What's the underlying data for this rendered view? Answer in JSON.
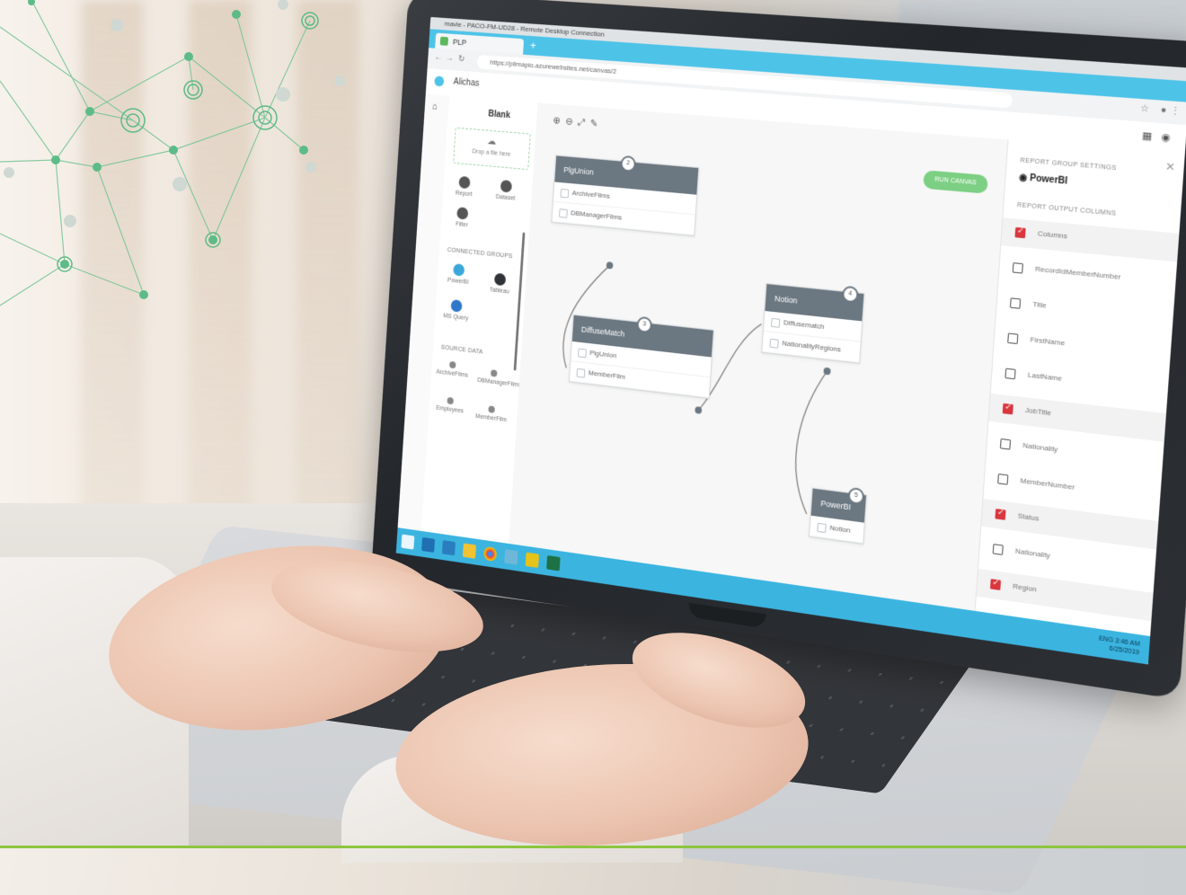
{
  "window_title": "mavle - PACO-FM-UD28 - Remote Desktop Connection",
  "browser": {
    "tab_label": "PLP",
    "url": "https://plimapio.azurewebsites.net/canvas/2"
  },
  "app": {
    "name": "Alichas"
  },
  "palette": {
    "title": "Blank",
    "dropzone": "Drop a file here",
    "items": [
      "Report",
      "Dataset",
      "Filter"
    ],
    "connected_section": "CONNECTED GROUPS",
    "connected_items": [
      "PowerBI",
      "Tableau",
      "MS Query"
    ],
    "sources_section": "SOURCE DATA",
    "source_items": [
      "ArchiveFilms",
      "DBManagerFilms",
      "Employees",
      "MemberFilm"
    ]
  },
  "canvas": {
    "run_button": "RUN CANVAS",
    "nodes": [
      {
        "title": "PlgUnion",
        "badge": "2",
        "rows": [
          "ArchiveFilms",
          "DBManagerFilms"
        ]
      },
      {
        "title": "DiffuseMatch",
        "badge": "3",
        "rows": [
          "PlgUnion",
          "MemberFilm"
        ]
      },
      {
        "title": "Notion",
        "badge": "4",
        "rows": [
          "Diffusematch",
          "NationalityRegions"
        ]
      },
      {
        "title": "PowerBI",
        "badge": "5",
        "rows": [
          "Notion"
        ]
      }
    ]
  },
  "right_panel": {
    "group_label": "REPORT GROUP SETTINGS",
    "group_value": "PowerBI",
    "columns_label": "REPORT OUTPUT COLUMNS",
    "columns": [
      {
        "name": "Columns",
        "checked": true
      },
      {
        "name": "RecordIdMemberNumber",
        "checked": false
      },
      {
        "name": "Title",
        "checked": false
      },
      {
        "name": "FirstName",
        "checked": false
      },
      {
        "name": "LastName",
        "checked": false
      },
      {
        "name": "JobTitle",
        "checked": true
      },
      {
        "name": "Nationality",
        "checked": false
      },
      {
        "name": "MemberNumber",
        "checked": false
      },
      {
        "name": "Status",
        "checked": true
      },
      {
        "name": "Nationality",
        "checked": false
      },
      {
        "name": "Region",
        "checked": true
      }
    ]
  },
  "taskbar": {
    "time": "3:46 AM",
    "date": "6/25/2019",
    "lang": "ENG"
  },
  "colors": {
    "accent_green": "#8cc63f",
    "network_green": "#5dbb87",
    "tab_blue": "#4ec3e8",
    "check_red": "#d9363e"
  }
}
